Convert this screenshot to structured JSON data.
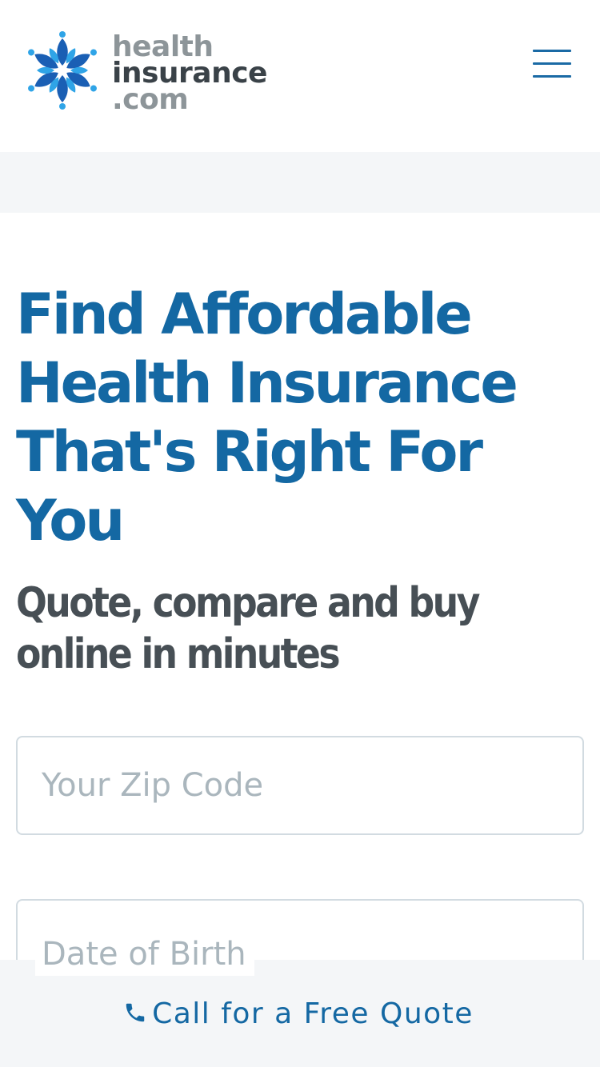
{
  "header": {
    "logo": {
      "line1": "health",
      "line2": "insurance",
      "line3": ".com"
    },
    "menu_icon": "hamburger-menu-icon"
  },
  "hero": {
    "title": "Find Affordable Health Insurance That's Right For You",
    "subtitle": "Quote, compare and buy online in minutes"
  },
  "form": {
    "zip_placeholder": "Your Zip Code",
    "dob_placeholder": "Date of Birth"
  },
  "cta": {
    "icon": "phone-icon",
    "label": "Call for a Free Quote"
  },
  "colors": {
    "brand_blue": "#1468a3",
    "logo_gray": "#8d9599",
    "logo_dark": "#3a4248",
    "subtitle_gray": "#474f55",
    "band_gray": "#f4f6f8",
    "field_border": "#d2dbe1",
    "placeholder": "#aab6bd"
  }
}
